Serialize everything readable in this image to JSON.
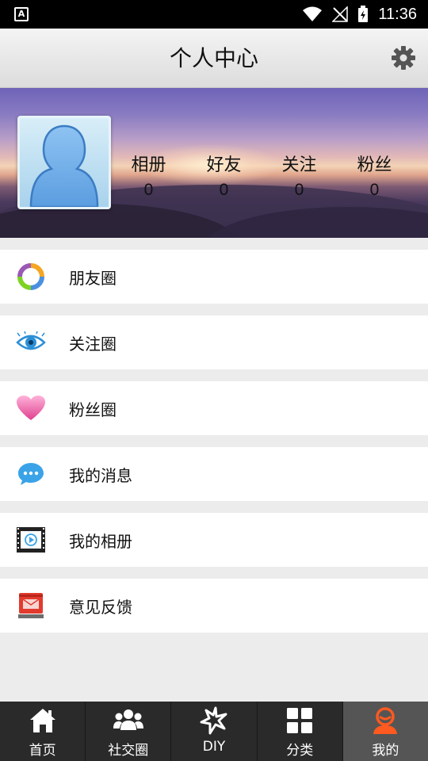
{
  "status_bar": {
    "app_icon_letter": "A",
    "time": "11:36"
  },
  "header": {
    "title": "个人中心",
    "settings_icon": "gear-icon"
  },
  "profile": {
    "avatar_icon": "user-silhouette-icon",
    "stats": [
      {
        "label": "相册",
        "value": "0"
      },
      {
        "label": "好友",
        "value": "0"
      },
      {
        "label": "关注",
        "value": "0"
      },
      {
        "label": "粉丝",
        "value": "0"
      }
    ]
  },
  "menu": {
    "items": [
      {
        "label": "朋友圈",
        "icon": "circle-arrows-icon"
      },
      {
        "label": "关注圈",
        "icon": "eye-icon"
      },
      {
        "label": "粉丝圈",
        "icon": "heart-icon"
      },
      {
        "label": "我的消息",
        "icon": "chat-bubble-icon"
      },
      {
        "label": "我的相册",
        "icon": "film-strip-icon"
      },
      {
        "label": "意见反馈",
        "icon": "mailbox-icon"
      }
    ]
  },
  "bottom_nav": {
    "items": [
      {
        "label": "首页",
        "icon": "home-icon"
      },
      {
        "label": "社交圈",
        "icon": "group-icon"
      },
      {
        "label": "DIY",
        "icon": "star-icon"
      },
      {
        "label": "分类",
        "icon": "grid-icon"
      },
      {
        "label": "我的",
        "icon": "person-icon",
        "active": true
      }
    ]
  },
  "colors": {
    "nav_background": "#2a2a2a",
    "nav_active": "#555555",
    "active_icon": "#ff5a1f",
    "page_background": "#ececec"
  }
}
